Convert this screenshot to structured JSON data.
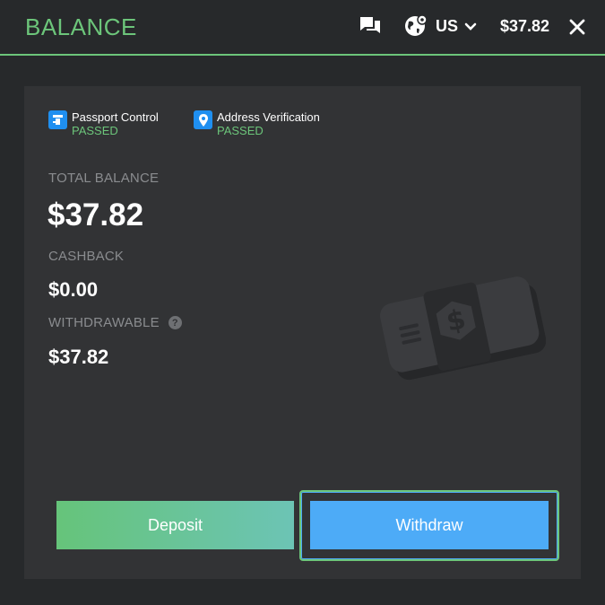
{
  "header": {
    "title": "BALANCE",
    "region": "US",
    "balance": "$37.82",
    "icons": [
      "chat-icon",
      "globe-icon",
      "chevron-down-icon",
      "close-icon"
    ],
    "accent_color": "#6cc57a"
  },
  "verifications": [
    {
      "label": "Passport Control",
      "status": "PASSED",
      "icon": "passport-icon"
    },
    {
      "label": "Address Verification",
      "status": "PASSED",
      "icon": "location-pin-icon"
    }
  ],
  "balance": {
    "total_label": "TOTAL BALANCE",
    "total_value": "$37.82",
    "cashback_label": "CASHBACK",
    "cashback_value": "$0.00",
    "withdrawable_label": "WITHDRAWABLE",
    "withdrawable_help": "?",
    "withdrawable_value": "$37.82"
  },
  "actions": {
    "deposit_label": "Deposit",
    "withdraw_label": "Withdraw",
    "deposit_color": "#66c47a",
    "withdraw_color": "#4dabf7"
  }
}
